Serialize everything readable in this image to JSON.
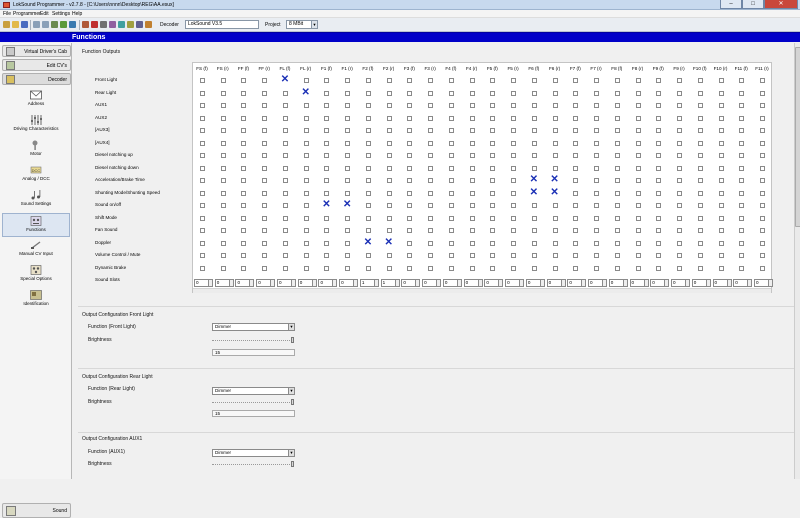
{
  "window": {
    "title": "LokSound Programmer - v2.7.8 - [C:\\Users\\nnnn\\Desktop\\REG\\AA.esux]",
    "minimize": "–",
    "maximize": "□",
    "close": "✕"
  },
  "menu": [
    "File",
    "Programmer",
    "Edit",
    "Settings",
    "Help"
  ],
  "toolbar": {
    "decoder_label": "Decoder",
    "decoder_value": "LokSound V3.5",
    "project_label": "Project",
    "project_value": "8 MBit"
  },
  "header": {
    "title": "Functions"
  },
  "sidebar": {
    "tabs": [
      "Virtual Driver's Cab",
      "Edit CV's",
      "Decoder"
    ],
    "items": [
      "Address",
      "Driving Characteristics",
      "Motor",
      "Analog / DCC",
      "Sound Settings",
      "Functions",
      "Manual CV Input",
      "Special Options",
      "Identification"
    ],
    "bottom_tab": "Sound"
  },
  "function_outputs": {
    "section_title": "Function Outputs",
    "columns": [
      "FS (f)",
      "FS (r)",
      "FF (f)",
      "FF (r)",
      "FL (f)",
      "FL (r)",
      "F1 (f)",
      "F1 (r)",
      "F2 (f)",
      "F2 (r)",
      "F3 (f)",
      "F3 (r)",
      "F4 (f)",
      "F4 (r)",
      "F5 (f)",
      "F5 (r)",
      "F6 (f)",
      "F6 (r)",
      "F7 (f)",
      "F7 (r)",
      "F8 (f)",
      "F8 (r)",
      "F9 (f)",
      "F9 (r)",
      "F10 (f)",
      "F10 (r)",
      "F11 (f)",
      "F11 (r)"
    ],
    "rows": [
      "Front Light",
      "Rear Light",
      "AUX1",
      "AUX2",
      "[AUX3]",
      "[AUX4]",
      "Diesel notching up",
      "Diesel notching down",
      "Acceleration/Brake Time",
      "Shunting Mode/Shunting Speed",
      "Sound on/off",
      "Shift Mode",
      "Fan Sound",
      "Doppler",
      "Volume Control / Mute",
      "Dynamic Brake",
      "Sound Slots"
    ],
    "checked": [
      [
        0,
        4
      ],
      [
        1,
        5
      ],
      [
        8,
        16
      ],
      [
        8,
        17
      ],
      [
        9,
        16
      ],
      [
        9,
        17
      ],
      [
        10,
        6
      ],
      [
        10,
        7
      ],
      [
        13,
        8
      ],
      [
        13,
        9
      ]
    ],
    "sound_slots": [
      "0",
      "0",
      "0",
      "0",
      "0",
      "0",
      "0",
      "0",
      "1",
      "1",
      "0",
      "0",
      "0",
      "0",
      "0",
      "0",
      "0",
      "0",
      "0",
      "0",
      "0",
      "0",
      "0",
      "0",
      "0",
      "0",
      "0",
      "0"
    ]
  },
  "configs": [
    {
      "title": "Output Configuration Front Light",
      "function_label": "Function (Front Light)",
      "function_value": "Dimmer",
      "brightness_label": "Brightness",
      "brightness_value": "15"
    },
    {
      "title": "Output Configuration Rear Light",
      "function_label": "Function (Rear Light)",
      "function_value": "Dimmer",
      "brightness_label": "Brightness",
      "brightness_value": "15"
    },
    {
      "title": "Output Configuration AUX1",
      "function_label": "Function (AUX1)",
      "function_value": "Dimmer",
      "brightness_label": "Brightness",
      "brightness_value": ""
    }
  ],
  "colors": {
    "header_blue": "#0000c8",
    "mark_blue": "#1a2fb5",
    "titlebar": "#c7d9ee"
  }
}
